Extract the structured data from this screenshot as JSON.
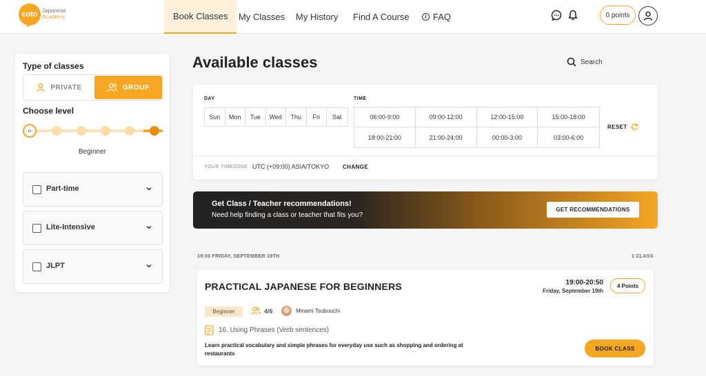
{
  "brand": {
    "logo_text": "coto",
    "name_line1": "Japanese",
    "name_line2": "Academy",
    "accent_color": "#f5a623"
  },
  "nav": {
    "tabs": [
      {
        "label": "Book Classes",
        "active": true
      },
      {
        "label": "My Classes",
        "active": false
      },
      {
        "label": "My History",
        "active": false
      },
      {
        "label": "Find A Course",
        "active": false
      },
      {
        "label": "FAQ",
        "active": false
      }
    ],
    "icons": [
      "chat-icon",
      "bell-icon",
      "user-icon"
    ],
    "points": "0 points"
  },
  "sidebar": {
    "type_heading": "Type of classes",
    "type_options": [
      {
        "label": "PRIVATE",
        "selected": false
      },
      {
        "label": "GROUP",
        "selected": true
      }
    ],
    "level_heading": "Choose level",
    "level_value": "Beginner",
    "level_steps": 6,
    "level_selected_index": 0,
    "filters": [
      {
        "label": "Part-time",
        "checked": false
      },
      {
        "label": "Lite-Intensive",
        "checked": false
      },
      {
        "label": "JLPT",
        "checked": false
      }
    ]
  },
  "main": {
    "title": "Available classes",
    "search_label": "Search",
    "day_label": "DAY",
    "days": [
      "Sun",
      "Mon",
      "Tue",
      "Wed",
      "Thu",
      "Fri",
      "Sat"
    ],
    "time_label": "TIME",
    "time_slots": [
      "06:00-9:00",
      "09:00-12:00",
      "12:00-15:00",
      "15:00-18:00",
      "18:00-21:00",
      "21:00-24:00",
      "00:00-3:00",
      "03:00-6:00"
    ],
    "reset_label": "RESET",
    "timezone_label": "YOUR TIMEZONE",
    "timezone_value": "UTC (+09:00) ASIA/TOKYO",
    "timezone_change": "CHANGE"
  },
  "recommendation": {
    "title": "Get Class / Teacher recommendations!",
    "subtitle": "Need help finding a class or teacher that fits you?",
    "button_label": "GET RECOMMENDATIONS"
  },
  "schedule": {
    "date_header": "19:00 FRIDAY, SEPTEMBER 19TH",
    "count_label": "1 CLASS",
    "classes": [
      {
        "title": "PRACTICAL JAPANESE FOR BEGINNERS",
        "time": "19:00-20:50",
        "date": "Friday, September 19th",
        "points": "4 Points",
        "level": "Beginner",
        "seats": "4/6",
        "teacher": "Minami Tsubouchi",
        "lesson": "16. Using Phrases (Verb sentences)",
        "description": "Learn practical vocabulary and simple phrases for everyday use such as shopping and ordering at restaurants",
        "book_label": "BOOK CLASS"
      }
    ]
  }
}
